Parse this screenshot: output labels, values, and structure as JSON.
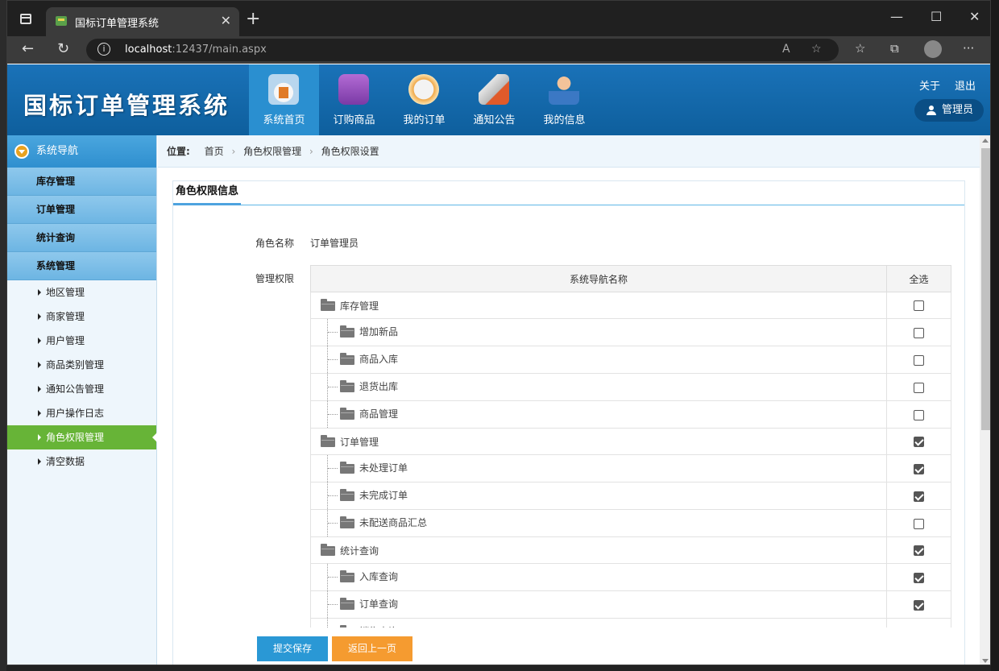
{
  "browser": {
    "tab_title": "国标订单管理系统",
    "url_host": "localhost",
    "url_path": ":12437/main.aspx",
    "new_tab": "+",
    "close_tab": "✕"
  },
  "app": {
    "logo": "国标订单管理系统",
    "nav": [
      {
        "label": "系统首页",
        "icon": "home-icon",
        "active": true
      },
      {
        "label": "订购商品",
        "icon": "shopping-icon",
        "active": false
      },
      {
        "label": "我的订单",
        "icon": "order-icon",
        "active": false
      },
      {
        "label": "通知公告",
        "icon": "megaphone-icon",
        "active": false
      },
      {
        "label": "我的信息",
        "icon": "user-profile-icon",
        "active": false
      }
    ],
    "about": "关于",
    "logout": "退出",
    "user": "管理员"
  },
  "sidebar": {
    "title": "系统导航",
    "groups": [
      "库存管理",
      "订单管理",
      "统计查询",
      "系统管理"
    ],
    "items": [
      "地区管理",
      "商家管理",
      "用户管理",
      "商品类别管理",
      "通知公告管理",
      "用户操作日志",
      "角色权限管理",
      "清空数据"
    ],
    "active_item": "角色权限管理"
  },
  "breadcrumb": {
    "label": "位置:",
    "items": [
      "首页",
      "角色权限管理",
      "角色权限设置"
    ]
  },
  "panel": {
    "title": "角色权限信息",
    "role_label": "角色名称",
    "role_value": "订单管理员",
    "perm_label": "管理权限",
    "col_name": "系统导航名称",
    "col_all": "全选",
    "rows": [
      {
        "name": "库存管理",
        "child": false,
        "checked": false
      },
      {
        "name": "增加新品",
        "child": true,
        "checked": false
      },
      {
        "name": "商品入库",
        "child": true,
        "checked": false
      },
      {
        "name": "退货出库",
        "child": true,
        "checked": false
      },
      {
        "name": "商品管理",
        "child": true,
        "checked": false
      },
      {
        "name": "订单管理",
        "child": false,
        "checked": true
      },
      {
        "name": "未处理订单",
        "child": true,
        "checked": true
      },
      {
        "name": "未完成订单",
        "child": true,
        "checked": true
      },
      {
        "name": "未配送商品汇总",
        "child": true,
        "checked": false
      },
      {
        "name": "统计查询",
        "child": false,
        "checked": true
      },
      {
        "name": "入库查询",
        "child": true,
        "checked": true
      },
      {
        "name": "订单查询",
        "child": true,
        "checked": true
      },
      {
        "name": "销售查询",
        "child": true,
        "checked": true
      }
    ]
  },
  "buttons": {
    "save": "提交保存",
    "back": "返回上一页"
  }
}
